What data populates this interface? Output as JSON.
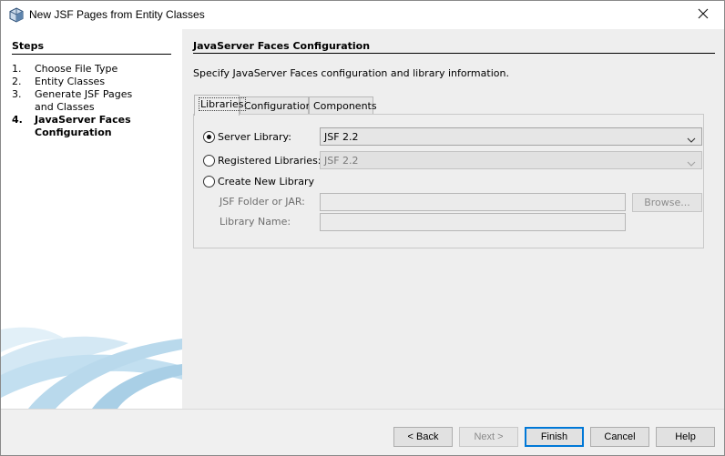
{
  "window": {
    "title": "New JSF Pages from Entity Classes",
    "icon": "netbeans-cube-icon",
    "close_icon": "close-icon"
  },
  "steps": {
    "title": "Steps",
    "items": [
      {
        "num": "1.",
        "label": "Choose File Type"
      },
      {
        "num": "2.",
        "label": "Entity Classes"
      },
      {
        "num": "3.",
        "label": "Generate JSF Pages and Classes"
      },
      {
        "num": "4.",
        "label": "JavaServer Faces Configuration"
      }
    ],
    "current_index": 3
  },
  "content": {
    "title": "JavaServer Faces Configuration",
    "description": "Specify JavaServer Faces configuration and library information.",
    "tabs": [
      {
        "label": "Libraries"
      },
      {
        "label": "Configuration"
      },
      {
        "label": "Components"
      }
    ],
    "active_tab": 0,
    "libraries": {
      "server_library": {
        "label": "Server Library:",
        "value": "JSF 2.2",
        "selected": true
      },
      "registered_libraries": {
        "label": "Registered Libraries:",
        "value": "JSF 2.2",
        "selected": false
      },
      "create_new_library": {
        "label": "Create New Library",
        "selected": false
      },
      "jsf_folder_label": "JSF Folder or JAR:",
      "jsf_folder_value": "",
      "browse_label": "Browse...",
      "library_name_label": "Library Name:",
      "library_name_value": ""
    }
  },
  "buttons": {
    "back": "< Back",
    "next": "Next >",
    "finish": "Finish",
    "cancel": "Cancel",
    "help": "Help"
  },
  "colors": {
    "default_button_border": "#0078d7",
    "swoosh": "#b9d9ec"
  }
}
